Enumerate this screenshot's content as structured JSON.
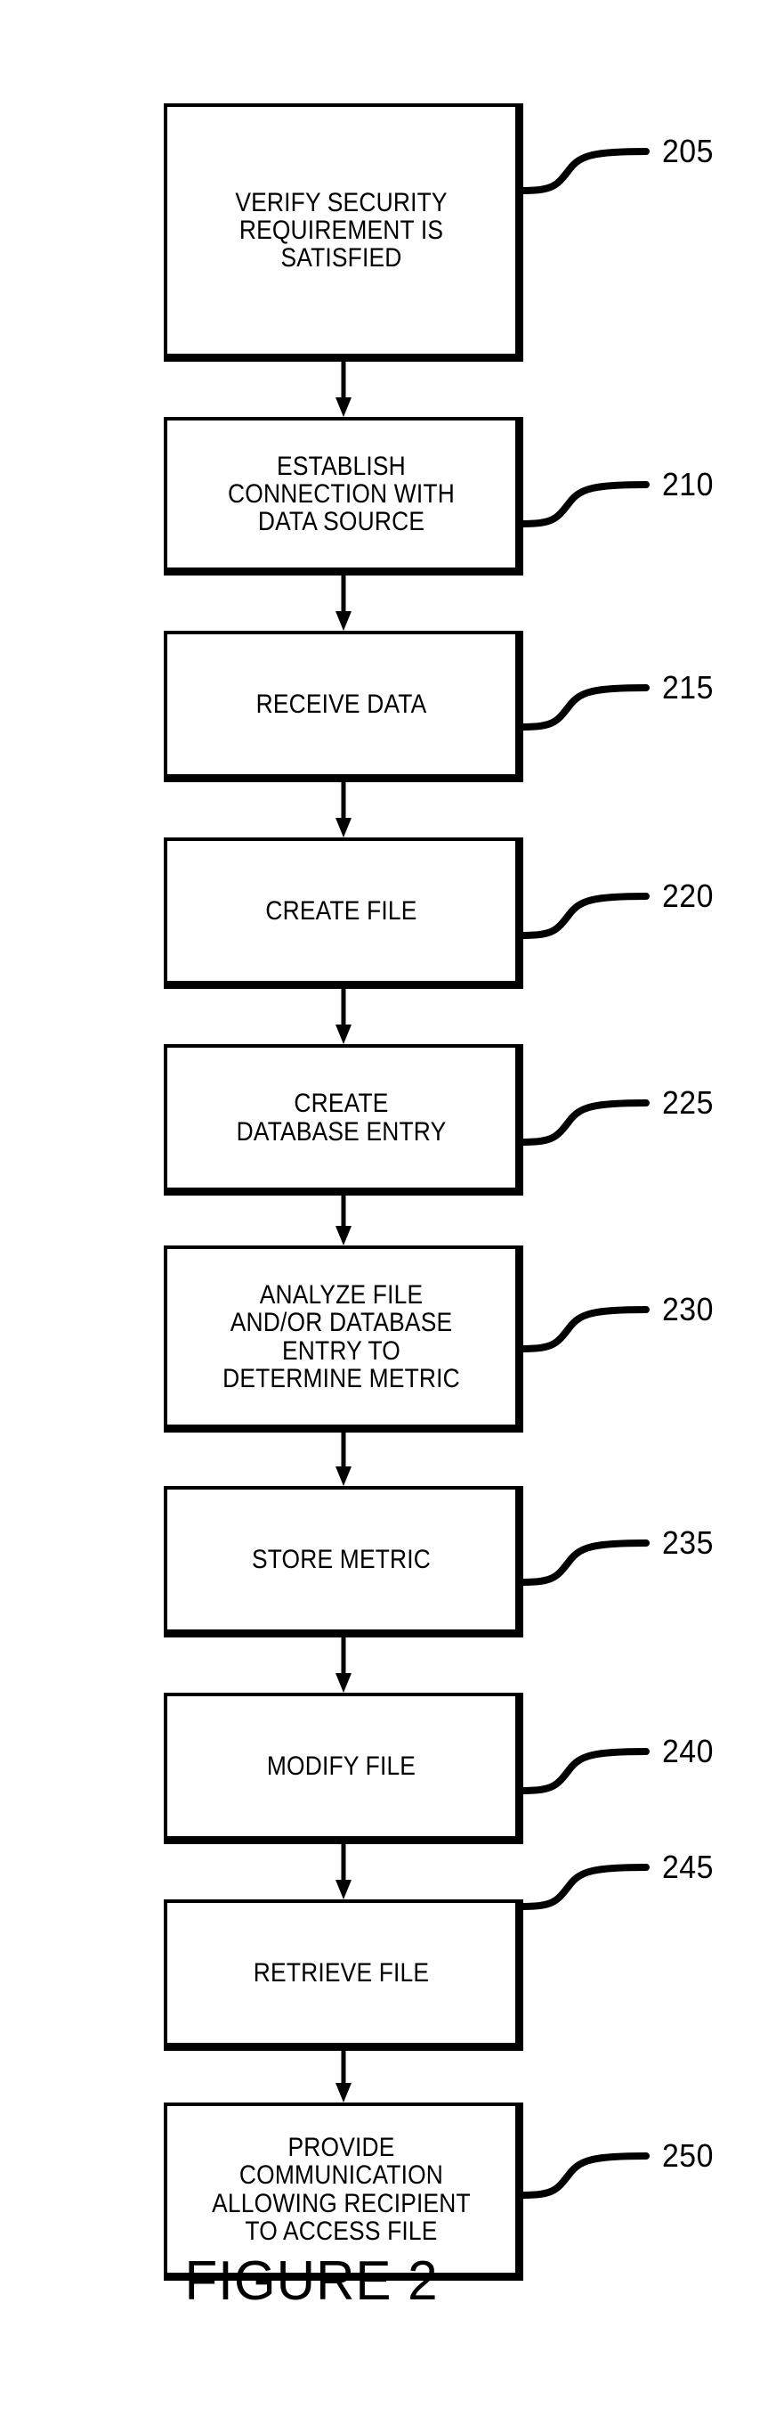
{
  "figure": {
    "caption": "FIGURE 2",
    "type": "patent-flowchart",
    "orientation": "vertical"
  },
  "steps": [
    {
      "ref": "205",
      "label": "VERIFY SECURITY\nREQUIREMENT IS\nSATISFIED",
      "lines": [
        "VERIFY SECURITY",
        "REQUIREMENT IS",
        "SATISFIED"
      ]
    },
    {
      "ref": "210",
      "label": "ESTABLISH\nCONNECTION WITH\nDATA SOURCE",
      "lines": [
        "ESTABLISH",
        "CONNECTION WITH",
        "DATA SOURCE"
      ]
    },
    {
      "ref": "215",
      "label": "RECEIVE DATA",
      "lines": [
        "RECEIVE DATA"
      ]
    },
    {
      "ref": "220",
      "label": "CREATE FILE",
      "lines": [
        "CREATE FILE"
      ]
    },
    {
      "ref": "225",
      "label": "CREATE\nDATABASE ENTRY",
      "lines": [
        "CREATE",
        "DATABASE ENTRY"
      ]
    },
    {
      "ref": "230",
      "label": "ANALYZE FILE\nAND/OR DATABASE\nENTRY TO\nDETERMINE METRIC",
      "lines": [
        "ANALYZE FILE",
        "AND/OR DATABASE",
        "ENTRY TO",
        "DETERMINE METRIC"
      ]
    },
    {
      "ref": "235",
      "label": "STORE METRIC",
      "lines": [
        "STORE METRIC"
      ]
    },
    {
      "ref": "240",
      "label": "MODIFY FILE",
      "lines": [
        "MODIFY FILE"
      ]
    },
    {
      "ref": "245",
      "label": "RETRIEVE FILE",
      "lines": [
        "RETRIEVE FILE"
      ]
    },
    {
      "ref": "250",
      "label": "PROVIDE\nCOMMUNICATION\nALLOWING RECIPIENT\nTO ACCESS FILE",
      "lines": [
        "PROVIDE",
        "COMMUNICATION",
        "ALLOWING RECIPIENT",
        "TO ACCESS FILE"
      ]
    }
  ],
  "flow": {
    "arrow_count": 9,
    "sequence": [
      "205",
      "210",
      "215",
      "220",
      "225",
      "230",
      "235",
      "240",
      "245",
      "250"
    ]
  },
  "colors": {
    "ink": "#000000",
    "paper": "#ffffff"
  }
}
